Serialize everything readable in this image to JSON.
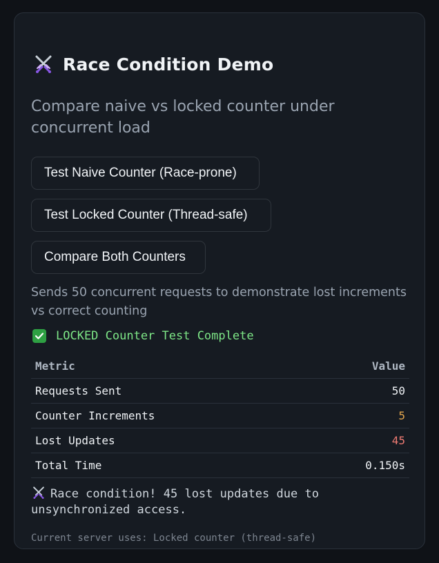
{
  "title": "Race Condition Demo",
  "title_icon": "crossed-swords-icon",
  "subtitle": "Compare naive vs locked counter under concurrent load",
  "buttons": {
    "naive": "Test Naive Counter (Race-prone)",
    "locked": "Test Locked Counter (Thread-safe)",
    "compare": "Compare Both Counters"
  },
  "hint": "Sends 50 concurrent requests to demonstrate lost increments vs correct counting",
  "status": {
    "icon": "check-mark-icon",
    "text": "LOCKED Counter Test Complete",
    "color": "#7ee787"
  },
  "table": {
    "headers": [
      "Metric",
      "Value"
    ],
    "rows": [
      {
        "metric": "Requests Sent",
        "value": "50"
      },
      {
        "metric": "Counter Increments",
        "value": "5"
      },
      {
        "metric": "Lost Updates",
        "value": "45"
      },
      {
        "metric": "Total Time",
        "value": "0.150s"
      }
    ],
    "colors": {
      "increments": "#e3a64d",
      "lost": "#f07b73"
    }
  },
  "message": {
    "icon": "crossed-swords-icon",
    "text": "Race condition! 45 lost updates due to unsynchronized access."
  },
  "server_note": "Current server uses: Locked counter (thread-safe)"
}
